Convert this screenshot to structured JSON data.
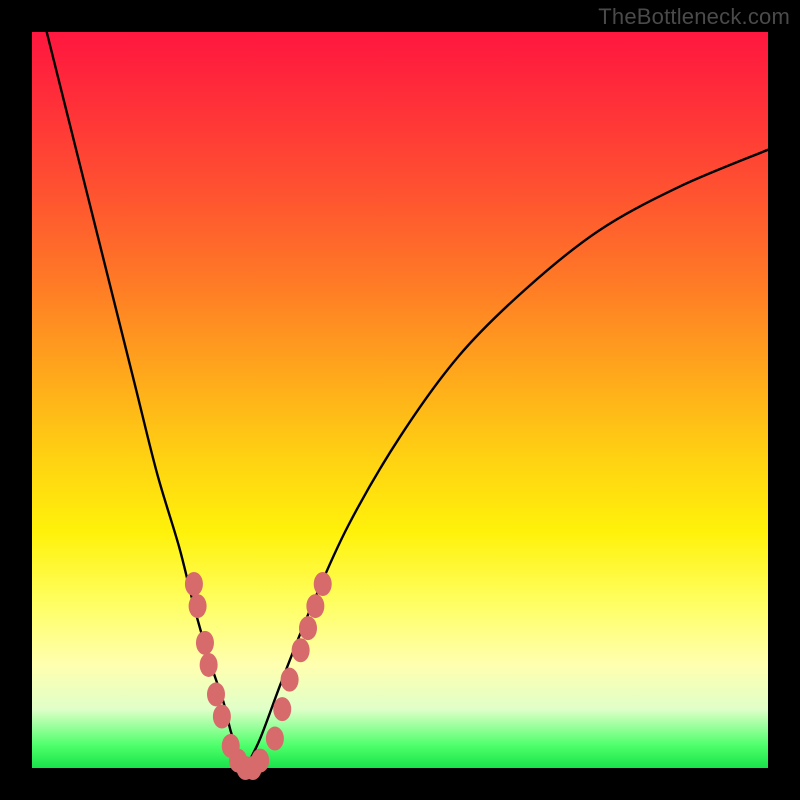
{
  "watermark": "TheBottleneck.com",
  "chart_data": {
    "type": "line",
    "title": "",
    "xlabel": "",
    "ylabel": "",
    "xlim": [
      0,
      100
    ],
    "ylim": [
      0,
      100
    ],
    "grid": false,
    "legend": false,
    "series": [
      {
        "name": "left-branch",
        "x": [
          2,
          5,
          8,
          11,
          14,
          17,
          20,
          22,
          24,
          26,
          27,
          28,
          29
        ],
        "y": [
          100,
          88,
          76,
          64,
          52,
          40,
          30,
          22,
          15,
          9,
          5,
          2,
          0
        ]
      },
      {
        "name": "right-branch",
        "x": [
          29,
          31,
          34,
          38,
          43,
          50,
          58,
          67,
          77,
          88,
          100
        ],
        "y": [
          0,
          4,
          12,
          22,
          33,
          45,
          56,
          65,
          73,
          79,
          84
        ]
      },
      {
        "name": "marker-cluster",
        "x": [
          22.0,
          22.5,
          23.5,
          24.0,
          25.0,
          25.8,
          27.0,
          28.0,
          29.0,
          30.0,
          31.0,
          33.0,
          34.0,
          35.0,
          36.5,
          37.5,
          38.5,
          39.5
        ],
        "y": [
          25,
          22,
          17,
          14,
          10,
          7,
          3,
          1,
          0,
          0,
          1,
          4,
          8,
          12,
          16,
          19,
          22,
          25
        ]
      }
    ],
    "colors": {
      "curve": "#000000",
      "markers": "#d76a6a",
      "background_top": "#ff173f",
      "background_bottom": "#19e24a"
    }
  }
}
